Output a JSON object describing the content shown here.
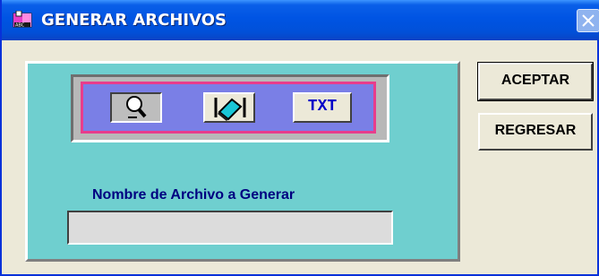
{
  "window": {
    "title": "GENERAR ARCHIVOS",
    "title_bar_color": "#0054e3",
    "app_icon": "book-icon"
  },
  "panel": {
    "background": "#6fcfcf",
    "toolbar": {
      "border_color": "#e83d8c",
      "background": "#7a7fe6",
      "buttons": [
        {
          "icon": "magnifier-icon",
          "state": "pressed"
        },
        {
          "icon": "eraser-icon",
          "state": "normal"
        },
        {
          "label": "TXT",
          "state": "normal"
        }
      ]
    },
    "filename": {
      "label": "Nombre de Archivo a Generar",
      "value": ""
    }
  },
  "actions": {
    "accept_label": "ACEPTAR",
    "back_label": "REGRESAR"
  }
}
